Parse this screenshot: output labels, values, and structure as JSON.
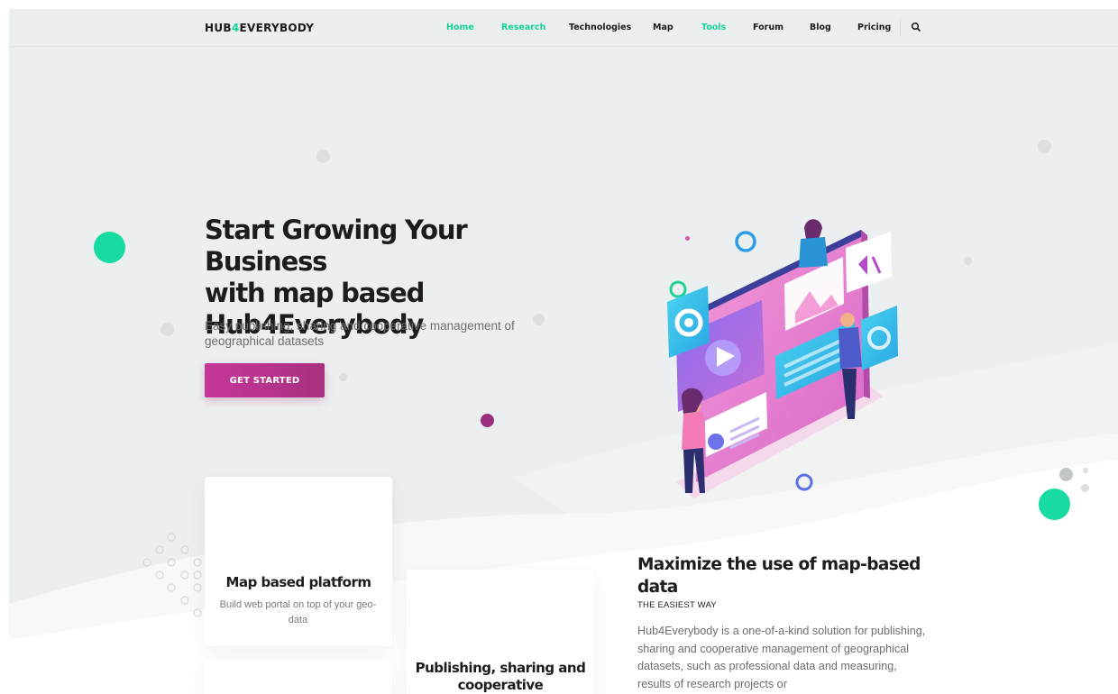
{
  "nav": {
    "logo_prefix": "HUB",
    "logo_highlight": "4",
    "logo_suffix": "EVERYBODY",
    "items": [
      {
        "label": "Home",
        "active": true
      },
      {
        "label": "Research",
        "active": true
      },
      {
        "label": "Technologies",
        "active": false
      },
      {
        "label": "Map",
        "active": false
      },
      {
        "label": "Tools",
        "active": true
      },
      {
        "label": "Forum",
        "active": false
      },
      {
        "label": "Blog",
        "active": false
      },
      {
        "label": "Pricing",
        "active": false
      }
    ],
    "search_icon": "search-icon"
  },
  "hero": {
    "title": "Start Growing Your Business\nwith map based\nHub4Everybody",
    "subtitle": "Easy publishing, sharing and cooperative management of geographical datasets",
    "cta_label": "GET STARTED"
  },
  "cards": [
    {
      "title": "Map based platform",
      "text": "Build web portal on top of your geo-data"
    },
    {
      "title": "Publishing, sharing and cooperative",
      "text": ""
    }
  ],
  "section": {
    "title": "Maximize the use of map-based data",
    "kicker": "THE EASIEST WAY",
    "body": "Hub4Everybody is a one-of-a-kind solution for publishing, sharing and cooperative management of geographical datasets, such as professional data and measuring, results of research projects or"
  },
  "colors": {
    "accent_green": "#14d49a",
    "cta_magenta": "#b8328c",
    "background": "#ecefef"
  }
}
